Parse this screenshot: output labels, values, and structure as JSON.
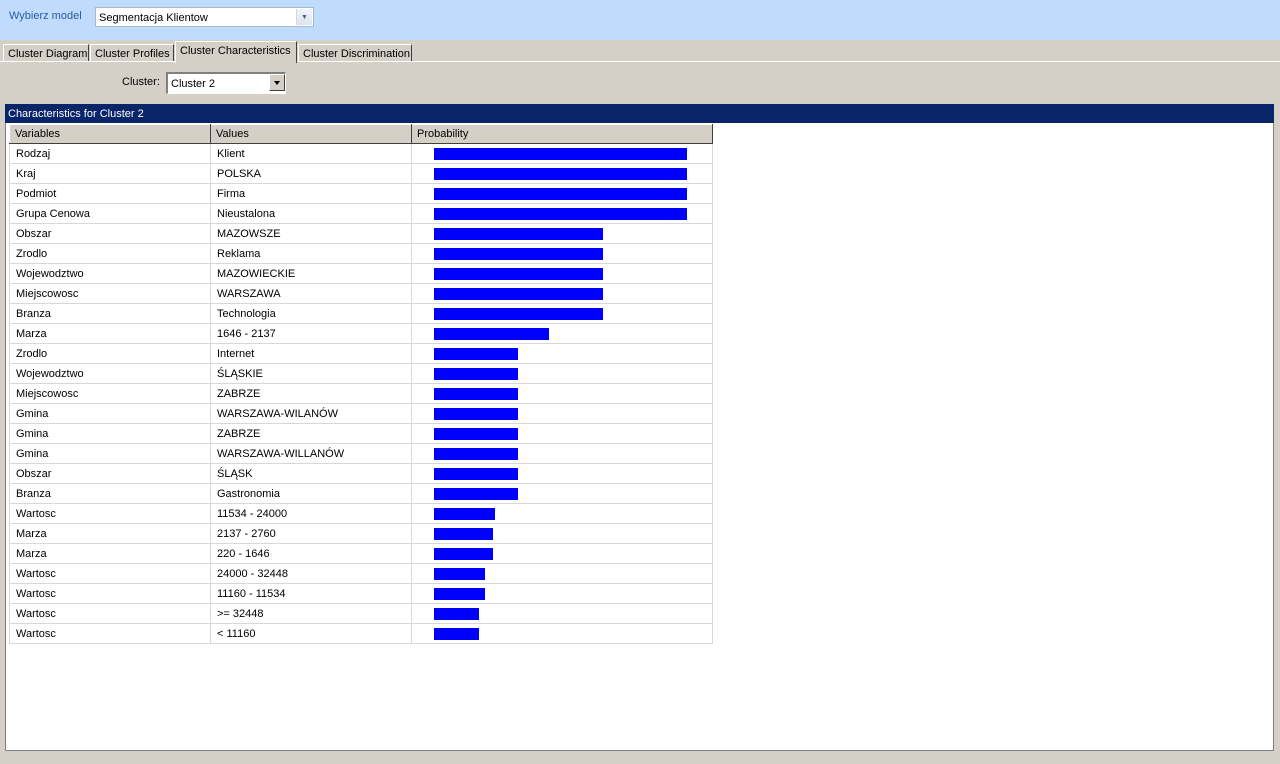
{
  "model": {
    "label": "Wybierz model",
    "selected": "Segmentacja Klientow"
  },
  "tabs": [
    {
      "label": "Cluster Diagram",
      "active": false
    },
    {
      "label": "Cluster Profiles",
      "active": false
    },
    {
      "label": "Cluster Characteristics",
      "active": true
    },
    {
      "label": "Cluster Discrimination",
      "active": false
    }
  ],
  "cluster": {
    "label": "Cluster:",
    "selected": "Cluster 2"
  },
  "characteristics": {
    "title": "Characteristics for Cluster 2",
    "columns": [
      "Variables",
      "Values",
      "Probability"
    ],
    "bar_color": "#0000ff",
    "rows": [
      {
        "variable": "Rodzaj",
        "value": "Klient",
        "probability": 0.99
      },
      {
        "variable": "Kraj",
        "value": "POLSKA",
        "probability": 0.99
      },
      {
        "variable": "Podmiot",
        "value": "Firma",
        "probability": 0.99
      },
      {
        "variable": "Grupa Cenowa",
        "value": "Nieustalona",
        "probability": 0.99
      },
      {
        "variable": "Obszar",
        "value": "MAZOWSZE",
        "probability": 0.66
      },
      {
        "variable": "Zrodlo",
        "value": "Reklama",
        "probability": 0.66
      },
      {
        "variable": "Wojewodztwo",
        "value": "MAZOWIECKIE",
        "probability": 0.66
      },
      {
        "variable": "Miejscowosc",
        "value": "WARSZAWA",
        "probability": 0.66
      },
      {
        "variable": "Branza",
        "value": "Technologia",
        "probability": 0.66
      },
      {
        "variable": "Marza",
        "value": "1646 - 2137",
        "probability": 0.45
      },
      {
        "variable": "Zrodlo",
        "value": "Internet",
        "probability": 0.33
      },
      {
        "variable": "Wojewodztwo",
        "value": "ŚLĄSKIE",
        "probability": 0.33
      },
      {
        "variable": "Miejscowosc",
        "value": "ZABRZE",
        "probability": 0.33
      },
      {
        "variable": "Gmina",
        "value": "WARSZAWA-WILANÓW",
        "probability": 0.33
      },
      {
        "variable": "Gmina",
        "value": "ZABRZE",
        "probability": 0.33
      },
      {
        "variable": "Gmina",
        "value": "WARSZAWA-WILLANÓW",
        "probability": 0.33
      },
      {
        "variable": "Obszar",
        "value": "ŚLĄSK",
        "probability": 0.33
      },
      {
        "variable": "Branza",
        "value": "Gastronomia",
        "probability": 0.33
      },
      {
        "variable": "Wartosc",
        "value": "11534 - 24000",
        "probability": 0.24
      },
      {
        "variable": "Marza",
        "value": "2137 - 2760",
        "probability": 0.23
      },
      {
        "variable": "Marza",
        "value": "220 - 1646",
        "probability": 0.23
      },
      {
        "variable": "Wartosc",
        "value": "24000 - 32448",
        "probability": 0.2
      },
      {
        "variable": "Wartosc",
        "value": "11160 - 11534",
        "probability": 0.2
      },
      {
        "variable": "Wartosc",
        "value": ">= 32448",
        "probability": 0.175
      },
      {
        "variable": "Wartosc",
        "value": "< 11160",
        "probability": 0.175
      }
    ]
  }
}
